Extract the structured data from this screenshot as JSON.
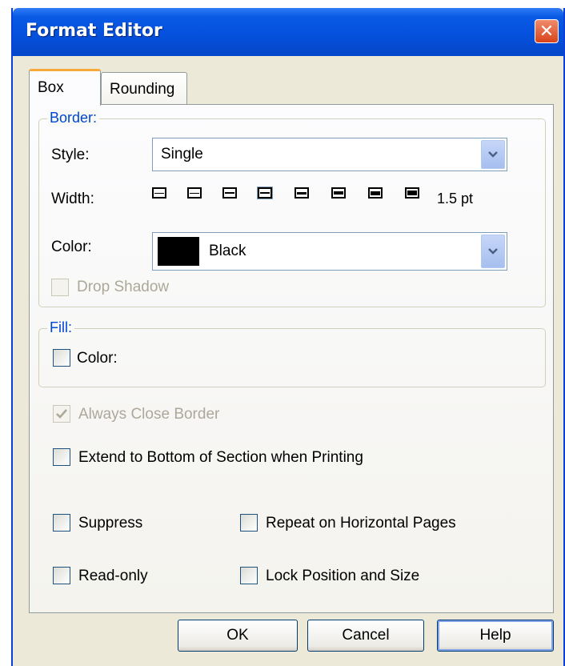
{
  "window": {
    "title": "Format Editor",
    "close_glyph": "✕"
  },
  "tabs": [
    {
      "label": "Box",
      "active": true
    },
    {
      "label": "Rounding",
      "active": false
    }
  ],
  "border": {
    "group_title": "Border:",
    "style_label": "Style:",
    "style_value": "Single",
    "width_label": "Width:",
    "width_options_count": 8,
    "width_value": "1.5 pt",
    "color_label": "Color:",
    "color_value": "Black",
    "color_swatch": "#000000",
    "drop_shadow_label": "Drop Shadow",
    "drop_shadow_checked": false,
    "drop_shadow_enabled": false
  },
  "fill": {
    "group_title": "Fill:",
    "color_label": "Color:",
    "color_checked": false
  },
  "options": {
    "always_close_border": {
      "label": "Always Close Border",
      "checked": true,
      "enabled": false
    },
    "extend_to_bottom": {
      "label": "Extend to Bottom of Section when Printing",
      "checked": false
    },
    "suppress": {
      "label": "Suppress",
      "checked": false
    },
    "repeat_on_horizontal": {
      "label": "Repeat on Horizontal Pages",
      "checked": false
    },
    "read_only": {
      "label": "Read-only",
      "checked": false
    },
    "lock_position_size": {
      "label": "Lock Position and Size",
      "checked": false
    }
  },
  "buttons": {
    "ok": "OK",
    "cancel": "Cancel",
    "help": "Help"
  },
  "colors": {
    "titlebar": "#0550dc",
    "dialog_bg": "#ece9d8",
    "group_title": "#0046d5",
    "disabled_text": "#aca899"
  }
}
